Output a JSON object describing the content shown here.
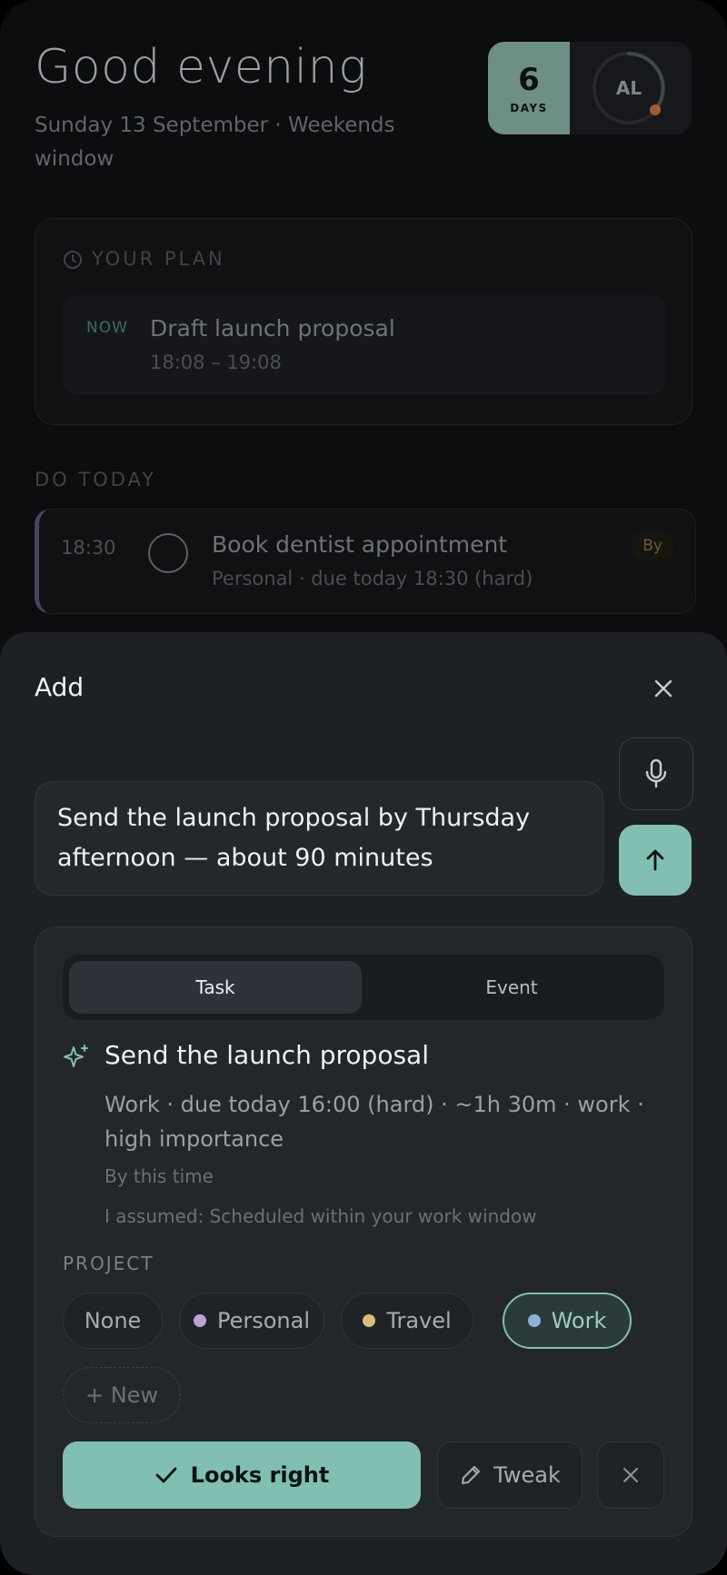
{
  "header": {
    "greeting": "Good evening",
    "date_line": "Sunday 13 September · Weekends window",
    "streak_count": "6",
    "streak_label": "DAYS",
    "avatar_initials": "AL"
  },
  "plan": {
    "heading": "YOUR PLAN",
    "item": {
      "badge": "NOW",
      "title": "Draft launch proposal",
      "time": "18:08 – 19:08"
    }
  },
  "today": {
    "heading": "DO TODAY",
    "task": {
      "time": "18:30",
      "title": "Book dentist appointment",
      "meta": "Personal · due today 18:30 (hard)",
      "tag": "By"
    }
  },
  "sheet": {
    "title": "Add",
    "input_value": "Send the launch proposal by Thursday afternoon — about 90 minutes",
    "tabs": [
      "Task",
      "Event"
    ],
    "active_tab": "Task",
    "preview": {
      "title": "Send the launch proposal",
      "meta": "Work · due today 16:00 (hard) · ~1h 30m · work · high importance",
      "by_text": "By this time",
      "assumption": "I assumed: Scheduled within your work window"
    },
    "project_label": "PROJECT",
    "projects": [
      {
        "label": "None",
        "color": ""
      },
      {
        "label": "Personal",
        "color": "#b9a3cf"
      },
      {
        "label": "Travel",
        "color": "#d7bc7e"
      },
      {
        "label": "Work",
        "color": "#8fb1d6"
      }
    ],
    "selected_project": "Work",
    "new_project_label": "+ New",
    "confirm_label": "Looks right",
    "tweak_label": "Tweak"
  },
  "colors": {
    "accent": "#80bfb1",
    "sheet_bg": "#1d2024",
    "card_bg": "#23272b"
  }
}
